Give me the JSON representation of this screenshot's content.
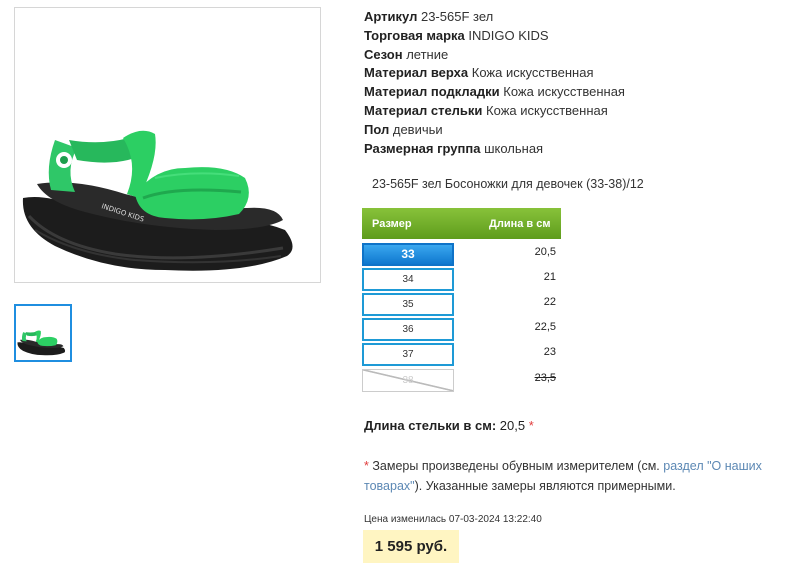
{
  "product": {
    "props": [
      {
        "key": "Артикул",
        "value": "23-565F зел"
      },
      {
        "key": "Торговая марка",
        "value": "INDIGO KIDS"
      },
      {
        "key": "Сезон",
        "value": "летние"
      },
      {
        "key": "Материал верха",
        "value": "Кожа искусственная"
      },
      {
        "key": "Материал подкладки",
        "value": "Кожа искусственная"
      },
      {
        "key": "Материал стельки",
        "value": "Кожа искусственная"
      },
      {
        "key": "Пол",
        "value": "девичьи"
      },
      {
        "key": "Размерная группа",
        "value": "школьная"
      }
    ],
    "title": "23-565F зел Босоножки для девочек (33-38)/12",
    "sole_text": "INDIGO KIDS"
  },
  "size_table": {
    "header_size": "Размер",
    "header_length": "Длина в см",
    "rows": [
      {
        "size": "33",
        "length": "20,5",
        "state": "active"
      },
      {
        "size": "34",
        "length": "21",
        "state": "normal"
      },
      {
        "size": "35",
        "length": "22",
        "state": "normal"
      },
      {
        "size": "36",
        "length": "22,5",
        "state": "normal"
      },
      {
        "size": "37",
        "length": "23",
        "state": "normal"
      },
      {
        "size": "38",
        "length": "23,5",
        "state": "disabled"
      }
    ]
  },
  "insole": {
    "label": "Длина стельки в см:",
    "value": "20,5",
    "mark": "*"
  },
  "note": {
    "star": "*",
    "text_before": "Замеры произведены обувным измерителем (см.",
    "link": "раздел \"О наших товарах\"",
    "text_after": "). Указанные замеры являются примерными."
  },
  "price_changed": "Цена изменилась 07-03-2024 13:22:40",
  "price": "1 595 руб.",
  "colors": {
    "accent_green": "#6aab24",
    "active_blue": "#1a86db",
    "price_bg": "#fff5c2"
  }
}
